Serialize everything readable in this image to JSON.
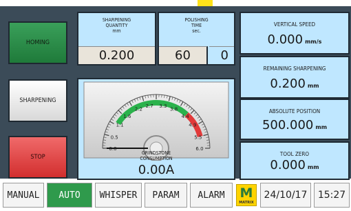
{
  "buttons": {
    "homing": "HOMING",
    "sharpening": "SHARPENING",
    "stop": "STOP"
  },
  "sharpening_qty": {
    "label": "SHARPENING\nQUANTITY\nmm",
    "value": "0.200"
  },
  "polishing_time": {
    "label": "POLISHING\nTIME\nsec.",
    "value": "60",
    "count": "0"
  },
  "vertical_speed": {
    "label": "VERTICAL SPEED",
    "value": "0.000",
    "unit": "mm/s"
  },
  "remaining_sharpening": {
    "label": "REMAINING SHARPENING",
    "value": "0.200",
    "unit": "mm"
  },
  "absolute_position": {
    "label": "ABSOLUTE POSITION",
    "value": "500.000",
    "unit": "mm"
  },
  "tool_zero": {
    "label": "TOOL ZERO",
    "value": "0.000",
    "unit": "mm"
  },
  "gauge": {
    "label": "GRINDSTONE\nCONSUMPTION",
    "value": "0.00A",
    "reading": 0.0,
    "min": 0.0,
    "max": 6.0,
    "green_range": [
      1.1,
      4.4
    ],
    "red_range": [
      4.4,
      5.5
    ],
    "ticks": [
      "0.0",
      "0.5",
      "1.1",
      "1.6",
      "2.2",
      "2.7",
      "3.3",
      "3.8",
      "4.4",
      "4.9",
      "5.5",
      "6.0"
    ],
    "colors": {
      "green": "#2bb24c",
      "red": "#e23a3a"
    }
  },
  "tabs": [
    "MANUAL",
    "AUTO",
    "WHISPER",
    "PARAM",
    "ALARM"
  ],
  "active_tab": "AUTO",
  "logo": {
    "letter": "M",
    "text": "MATRIX"
  },
  "date": "24/10/17",
  "time": "15:27"
}
